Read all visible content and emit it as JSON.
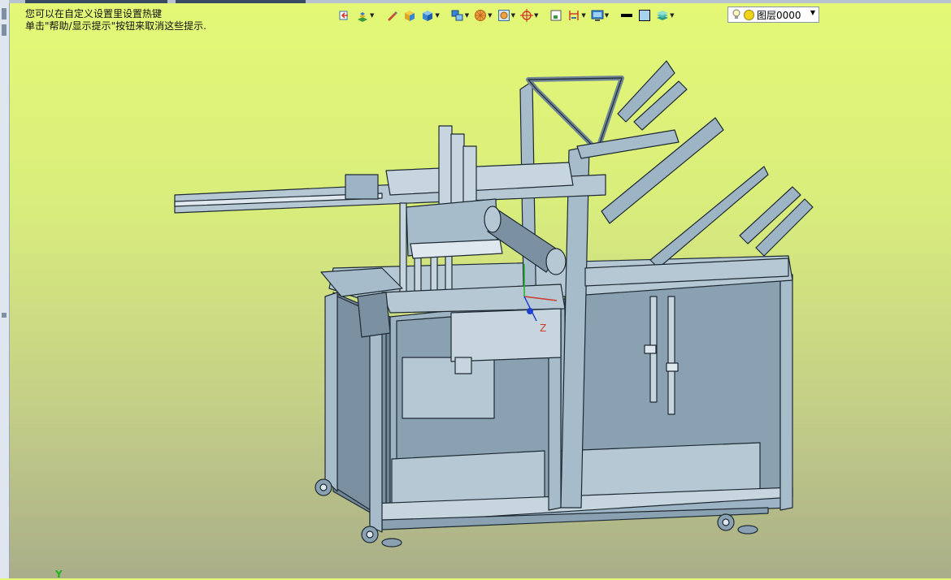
{
  "hints": {
    "line1": "您可以在自定义设置里设置热键",
    "line2": "单击\"帮助/显示提示\"按钮来取消这些提示."
  },
  "toolbar": {
    "buttons": [
      {
        "icon": "view-orient-icon",
        "dropdown": false
      },
      {
        "icon": "display-style-icon",
        "dropdown": true
      },
      {
        "icon": "pen-edit-icon",
        "dropdown": false
      },
      {
        "icon": "part-cube-icon",
        "dropdown": false
      },
      {
        "icon": "solid-cube-icon",
        "dropdown": true
      },
      {
        "icon": "assembly-cubes-icon",
        "dropdown": true
      },
      {
        "icon": "sphere-render-icon",
        "dropdown": true
      },
      {
        "icon": "section-view-icon",
        "dropdown": true
      },
      {
        "icon": "target-snap-icon",
        "dropdown": true
      },
      {
        "icon": "zoom-window-icon",
        "dropdown": false
      },
      {
        "icon": "dimension-icon",
        "dropdown": true
      },
      {
        "icon": "monitor-view-icon",
        "dropdown": true
      },
      {
        "icon": "line-color-icon",
        "dropdown": false
      },
      {
        "icon": "face-color-icon",
        "dropdown": false
      },
      {
        "icon": "layers-stack-icon",
        "dropdown": true
      }
    ]
  },
  "layer_selector": {
    "value": "图层0000",
    "bulb_icon": "lightbulb-icon"
  },
  "viewport": {
    "model": "packaging-machine-assembly",
    "axis_label_y": "Y",
    "triad_label_z": "Z"
  },
  "colors": {
    "model_body": "#9db4c4",
    "model_edge": "#1e2a33",
    "panel_dark": "#6f8596",
    "background_top": "#e4f876",
    "background_bottom": "#a9ae89"
  }
}
